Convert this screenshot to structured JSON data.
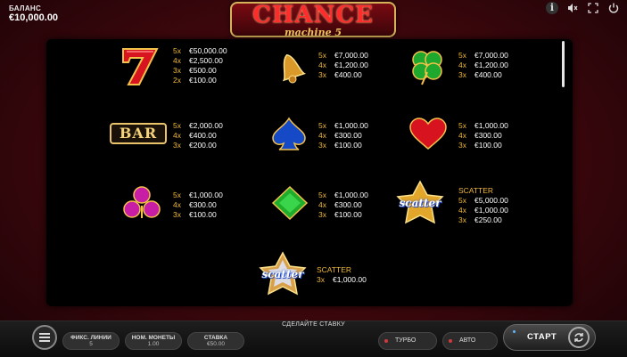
{
  "header": {
    "balance_label": "БАЛАНС",
    "balance_value": "€10,000.00",
    "logo_title": "CHANCE",
    "logo_subtitle": "machine 5",
    "icons": [
      "info-icon",
      "mute-icon",
      "fullscreen-icon",
      "power-icon"
    ]
  },
  "paytable": {
    "symbols": [
      {
        "name": "seven",
        "payouts": [
          [
            "5x",
            "€50,000.00"
          ],
          [
            "4x",
            "€2,500.00"
          ],
          [
            "3x",
            "€500.00"
          ],
          [
            "2x",
            "€100.00"
          ]
        ]
      },
      {
        "name": "bell",
        "payouts": [
          [
            "5x",
            "€7,000.00"
          ],
          [
            "4x",
            "€1,200.00"
          ],
          [
            "3x",
            "€400.00"
          ]
        ]
      },
      {
        "name": "clover",
        "payouts": [
          [
            "5x",
            "€7,000.00"
          ],
          [
            "4x",
            "€1,200.00"
          ],
          [
            "3x",
            "€400.00"
          ]
        ]
      },
      {
        "name": "bar",
        "label": "BAR",
        "payouts": [
          [
            "5x",
            "€2,000.00"
          ],
          [
            "4x",
            "€400.00"
          ],
          [
            "3x",
            "€200.00"
          ]
        ]
      },
      {
        "name": "spade",
        "payouts": [
          [
            "5x",
            "€1,000.00"
          ],
          [
            "4x",
            "€300.00"
          ],
          [
            "3x",
            "€100.00"
          ]
        ]
      },
      {
        "name": "heart",
        "payouts": [
          [
            "5x",
            "€1,000.00"
          ],
          [
            "4x",
            "€300.00"
          ],
          [
            "3x",
            "€100.00"
          ]
        ]
      },
      {
        "name": "club",
        "payouts": [
          [
            "5x",
            "€1,000.00"
          ],
          [
            "4x",
            "€300.00"
          ],
          [
            "3x",
            "€100.00"
          ]
        ]
      },
      {
        "name": "diamond",
        "payouts": [
          [
            "5x",
            "€1,000.00"
          ],
          [
            "4x",
            "€300.00"
          ],
          [
            "3x",
            "€100.00"
          ]
        ]
      },
      {
        "name": "scatter-gold",
        "label": "SCATTER",
        "symbol_text": "scatter",
        "payouts": [
          [
            "5x",
            "€5,000.00"
          ],
          [
            "4x",
            "€1,000.00"
          ],
          [
            "3x",
            "€250.00"
          ]
        ]
      },
      {
        "name": "scatter-silver",
        "label": "SCATTER",
        "symbol_text": "scatter",
        "payouts": [
          [
            "3x",
            "€1,000.00"
          ]
        ]
      }
    ]
  },
  "bottom": {
    "bet_prompt": "СДЕЛАЙТЕ СТАВКУ",
    "fixed_lines_label": "ФИКС. ЛИНИИ",
    "fixed_lines_value": "5",
    "coin_value_label": "НОМ. МОНЕТЫ",
    "coin_value": "1.00",
    "bet_label": "СТАВКА",
    "bet_value": "€50.00",
    "turbo_label": "ТУРБО",
    "auto_label": "АВТО",
    "start_label": "СТАРТ"
  },
  "colors": {
    "accent": "#f0b93a",
    "background": "#3a070c",
    "panel": "#000000"
  }
}
